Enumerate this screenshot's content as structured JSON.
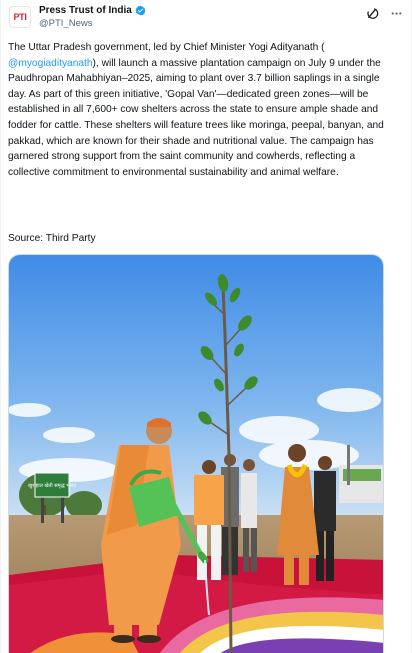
{
  "tweet": {
    "author": {
      "name": "Press Trust of India",
      "handle": "@PTI_News",
      "avatar_text": "PTI",
      "verified": true
    },
    "text_before_mention": "The Uttar Pradesh government, led by Chief Minister Yogi Adityanath ( ",
    "mention": "@myogiadityanath",
    "text_after_mention": "), will launch a massive plantation campaign on July 9 under the Paudhropan Mahabhiyan–2025, aiming to plant over 3.7 billion saplings in a single day. As part of this green initiative, 'Gopal Van'—dedicated green zones—will be established in all 7,600+ cow shelters across the state to ensure ample shade and fodder for cattle. These shelters will feature trees like moringa, peepal, banyan, and pakkad, which are known for their shade and nutritional value. The campaign has garnered strong support from the saint community and cowherds, reflecting a collective commitment to environmental sustainability and animal welfare.",
    "source": "Source: Third Party",
    "media_sign_text": "खुशहाल खेती समृद्ध भारत"
  },
  "icons": {
    "verified": "verified-badge-icon",
    "grok": "grok-icon",
    "more": "more-options-icon"
  },
  "colors": {
    "accent": "#1d9bf0",
    "text": "#0f1419",
    "muted": "#536471",
    "avatar_brand": "#d7262b"
  }
}
